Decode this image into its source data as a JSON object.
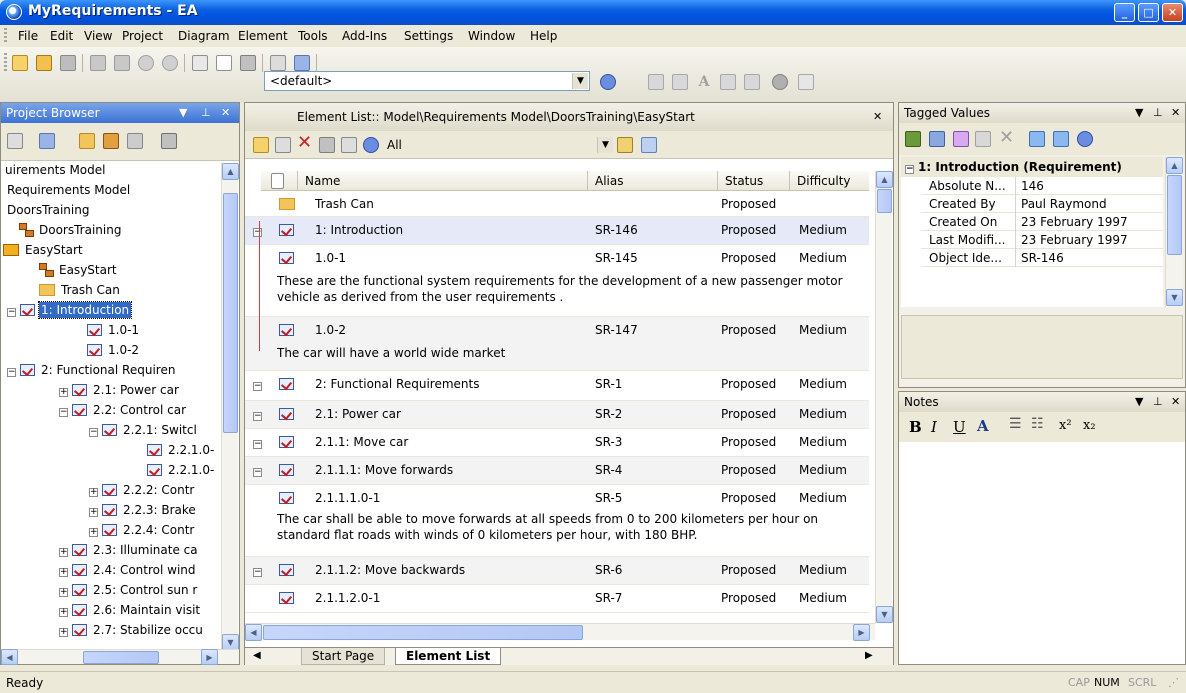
{
  "window": {
    "title": "MyRequirements - EA"
  },
  "menu": [
    "File",
    "Edit",
    "View",
    "Project",
    "Diagram",
    "Element",
    "Tools",
    "Add-Ins",
    "Settings",
    "Window",
    "Help"
  ],
  "toolbar": {
    "profile_select": "<default>"
  },
  "project_browser": {
    "title": "Project Browser",
    "tree": [
      {
        "label": "uirements Model",
        "indent": 0,
        "icon": "none"
      },
      {
        "label": "Requirements Model",
        "indent": 0,
        "icon": "none"
      },
      {
        "label": "DoorsTraining",
        "indent": 0,
        "icon": "none"
      },
      {
        "label": "DoorsTraining",
        "indent": 1,
        "icon": "package-diagram-icon"
      },
      {
        "label": "EasyStart",
        "indent": 0,
        "icon": "package-icon"
      },
      {
        "label": "EasyStart",
        "indent": 2,
        "icon": "package-diagram-icon"
      },
      {
        "label": "Trash Can",
        "indent": 2,
        "icon": "folder-icon"
      },
      {
        "label": "1: Introduction",
        "indent": 1,
        "icon": "requirement-icon",
        "expander": "-",
        "selected": true
      },
      {
        "label": "1.0-1",
        "indent": 3,
        "icon": "requirement-icon"
      },
      {
        "label": "1.0-2",
        "indent": 3,
        "icon": "requirement-icon"
      },
      {
        "label": "2: Functional Requiren",
        "indent": 1,
        "icon": "requirement-icon",
        "expander": "-"
      },
      {
        "label": "2.1: Power car",
        "indent": 2,
        "icon": "requirement-icon",
        "expander": "+"
      },
      {
        "label": "2.2: Control car",
        "indent": 2,
        "icon": "requirement-icon",
        "expander": "-"
      },
      {
        "label": "2.2.1: Switcl",
        "indent": 3,
        "icon": "requirement-icon",
        "expander": "-"
      },
      {
        "label": "2.2.1.0-",
        "indent": 5,
        "icon": "requirement-icon"
      },
      {
        "label": "2.2.1.0-",
        "indent": 5,
        "icon": "requirement-icon"
      },
      {
        "label": "2.2.2: Contr",
        "indent": 3,
        "icon": "requirement-icon",
        "expander": "+"
      },
      {
        "label": "2.2.3: Brake",
        "indent": 3,
        "icon": "requirement-icon",
        "expander": "+"
      },
      {
        "label": "2.2.4: Contr",
        "indent": 3,
        "icon": "requirement-icon",
        "expander": "+"
      },
      {
        "label": "2.3: Illuminate ca",
        "indent": 2,
        "icon": "requirement-icon",
        "expander": "+"
      },
      {
        "label": "2.4: Control wind",
        "indent": 2,
        "icon": "requirement-icon",
        "expander": "+"
      },
      {
        "label": "2.5: Control sun r",
        "indent": 2,
        "icon": "requirement-icon",
        "expander": "+"
      },
      {
        "label": "2.6: Maintain visit",
        "indent": 2,
        "icon": "requirement-icon",
        "expander": "+"
      },
      {
        "label": "2.7: Stabilize occu",
        "indent": 2,
        "icon": "requirement-icon",
        "expander": "+"
      }
    ]
  },
  "element_list": {
    "title": "Element List:: Model\\Requirements Model\\DoorsTraining\\EasyStart",
    "filter": "All",
    "columns": [
      "Name",
      "Alias",
      "Status",
      "Difficulty"
    ],
    "rows": [
      {
        "name": "Trash Can",
        "alias": "",
        "status": "Proposed",
        "difficulty": "",
        "icon": "folder",
        "notes": ""
      },
      {
        "name": "1: Introduction",
        "alias": "SR-146",
        "status": "Proposed",
        "difficulty": "Medium",
        "icon": "req",
        "notes": "",
        "selected": true
      },
      {
        "name": "1.0-1",
        "alias": "SR-145",
        "status": "Proposed",
        "difficulty": "Medium",
        "icon": "req",
        "notes": "These are the functional system requirements for the development of a new passenger motor vehicle as derived from the user requirements ."
      },
      {
        "name": "1.0-2",
        "alias": "SR-147",
        "status": "Proposed",
        "difficulty": "Medium",
        "icon": "req",
        "notes": "The car will have a world wide market"
      },
      {
        "name": "2: Functional Requirements",
        "alias": "SR-1",
        "status": "Proposed",
        "difficulty": "Medium",
        "icon": "req",
        "notes": ""
      },
      {
        "name": "2.1: Power car",
        "alias": "SR-2",
        "status": "Proposed",
        "difficulty": "Medium",
        "icon": "req",
        "notes": ""
      },
      {
        "name": "2.1.1: Move car",
        "alias": "SR-3",
        "status": "Proposed",
        "difficulty": "Medium",
        "icon": "req",
        "notes": ""
      },
      {
        "name": "2.1.1.1: Move forwards",
        "alias": "SR-4",
        "status": "Proposed",
        "difficulty": "Medium",
        "icon": "req",
        "notes": ""
      },
      {
        "name": "2.1.1.1.0-1",
        "alias": "SR-5",
        "status": "Proposed",
        "difficulty": "Medium",
        "icon": "req",
        "notes": "The car shall be able to move forwards at all speeds from 0 to 200 kilometers per hour on standard flat roads with winds of 0 kilometers per hour, with 180 BHP."
      },
      {
        "name": "2.1.1.2: Move backwards",
        "alias": "SR-6",
        "status": "Proposed",
        "difficulty": "Medium",
        "icon": "req",
        "notes": ""
      },
      {
        "name": "2.1.1.2.0-1",
        "alias": "SR-7",
        "status": "Proposed",
        "difficulty": "Medium",
        "icon": "req",
        "notes": ""
      }
    ],
    "tabs": [
      "Start Page",
      "Element List"
    ]
  },
  "tagged_values": {
    "title": "Tagged Values",
    "group": "1: Introduction (Requirement)",
    "rows": [
      {
        "key": "Absolute N...",
        "value": "146"
      },
      {
        "key": "Created By",
        "value": "Paul Raymond"
      },
      {
        "key": "Created On",
        "value": "23 February 1997"
      },
      {
        "key": "Last Modifi...",
        "value": "23 February 1997"
      },
      {
        "key": "Object Ide...",
        "value": "SR-146"
      }
    ]
  },
  "notes": {
    "title": "Notes",
    "format_buttons": [
      "B",
      "I",
      "U"
    ]
  },
  "status_bar": {
    "text": "Ready",
    "cap": "CAP",
    "num": "NUM",
    "scrl": "SCRL"
  }
}
